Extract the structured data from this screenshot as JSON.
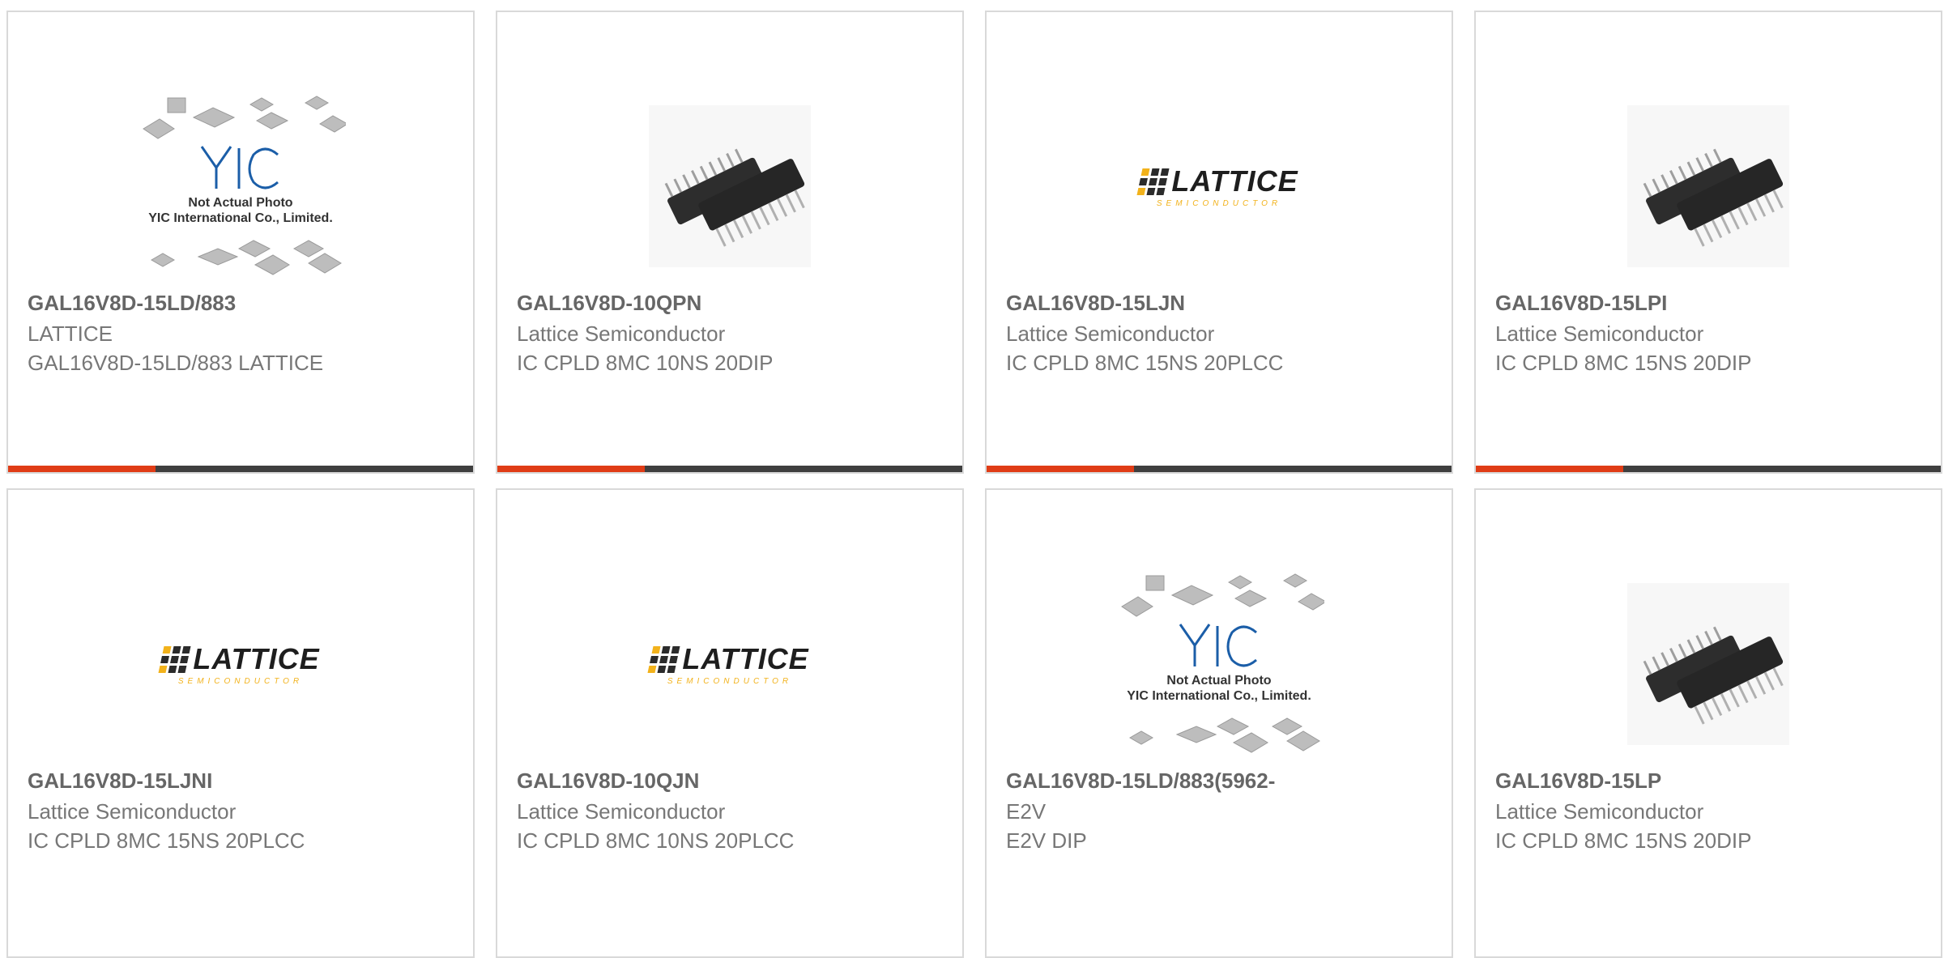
{
  "products": [
    {
      "part_number": "GAL16V8D-15LD/883",
      "manufacturer": "LATTICE",
      "description": "GAL16V8D-15LD/883 LATTICE",
      "image": "placeholder"
    },
    {
      "part_number": "GAL16V8D-10QPN",
      "manufacturer": "Lattice Semiconductor",
      "description": "IC CPLD 8MC 10NS 20DIP",
      "image": "dip-chip"
    },
    {
      "part_number": "GAL16V8D-15LJN",
      "manufacturer": "Lattice Semiconductor",
      "description": "IC CPLD 8MC 15NS 20PLCC",
      "image": "lattice-logo"
    },
    {
      "part_number": "GAL16V8D-15LPI",
      "manufacturer": "Lattice Semiconductor",
      "description": "IC CPLD 8MC 15NS 20DIP",
      "image": "dip-chip"
    },
    {
      "part_number": "GAL16V8D-15LJNI",
      "manufacturer": "Lattice Semiconductor",
      "description": "IC CPLD 8MC 15NS 20PLCC",
      "image": "lattice-logo"
    },
    {
      "part_number": "GAL16V8D-10QJN",
      "manufacturer": "Lattice Semiconductor",
      "description": "IC CPLD 8MC 10NS 20PLCC",
      "image": "lattice-logo"
    },
    {
      "part_number": "GAL16V8D-15LD/883(5962-",
      "manufacturer": "E2V",
      "description": "E2V DIP",
      "image": "placeholder"
    },
    {
      "part_number": "GAL16V8D-15LP",
      "manufacturer": "Lattice Semiconductor",
      "description": "IC CPLD 8MC 15NS 20DIP",
      "image": "dip-chip"
    }
  ],
  "placeholder": {
    "line1": "Not Actual Photo",
    "line2": "YIC International Co., Limited.",
    "logo": "YIC"
  },
  "lattice_logo": {
    "word": "LATTICE",
    "sub": "SEMICONDUCTOR"
  },
  "colors": {
    "accent": "#e03c16",
    "bar": "#3f3f3f",
    "border": "#d9d9d9"
  }
}
